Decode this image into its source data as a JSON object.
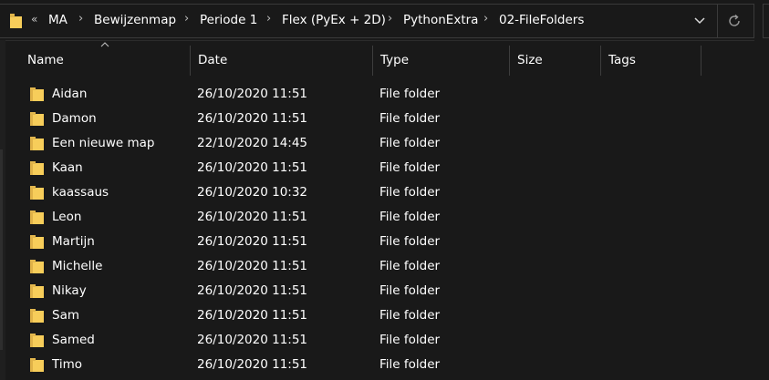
{
  "addressbar": {
    "overflow": "«",
    "crumbs": [
      "MA",
      "Bewijzenmap",
      "Periode 1",
      "Flex (PyEx + 2D)",
      "PythonExtra",
      "02-FileFolders"
    ],
    "separator": "›",
    "dropdown_icon": "chevron-down-icon",
    "refresh_icon": "refresh-icon"
  },
  "columns": {
    "name": "Name",
    "date": "Date",
    "type": "Type",
    "size": "Size",
    "tags": "Tags",
    "sorted_by": "name",
    "sort_direction": "ascending"
  },
  "folder_color": "#f7cd5a",
  "files": [
    {
      "name": "Aidan",
      "date": "26/10/2020 11:51",
      "type": "File folder"
    },
    {
      "name": "Damon",
      "date": "26/10/2020 11:51",
      "type": "File folder"
    },
    {
      "name": "Een nieuwe map",
      "date": "22/10/2020 14:45",
      "type": "File folder"
    },
    {
      "name": "Kaan",
      "date": "26/10/2020 11:51",
      "type": "File folder"
    },
    {
      "name": "kaassaus",
      "date": "26/10/2020 10:32",
      "type": "File folder"
    },
    {
      "name": "Leon",
      "date": "26/10/2020 11:51",
      "type": "File folder"
    },
    {
      "name": "Martijn",
      "date": "26/10/2020 11:51",
      "type": "File folder"
    },
    {
      "name": "Michelle",
      "date": "26/10/2020 11:51",
      "type": "File folder"
    },
    {
      "name": "Nikay",
      "date": "26/10/2020 11:51",
      "type": "File folder"
    },
    {
      "name": "Sam",
      "date": "26/10/2020 11:51",
      "type": "File folder"
    },
    {
      "name": "Samed",
      "date": "26/10/2020 11:51",
      "type": "File folder"
    },
    {
      "name": "Timo",
      "date": "26/10/2020 11:51",
      "type": "File folder"
    }
  ]
}
